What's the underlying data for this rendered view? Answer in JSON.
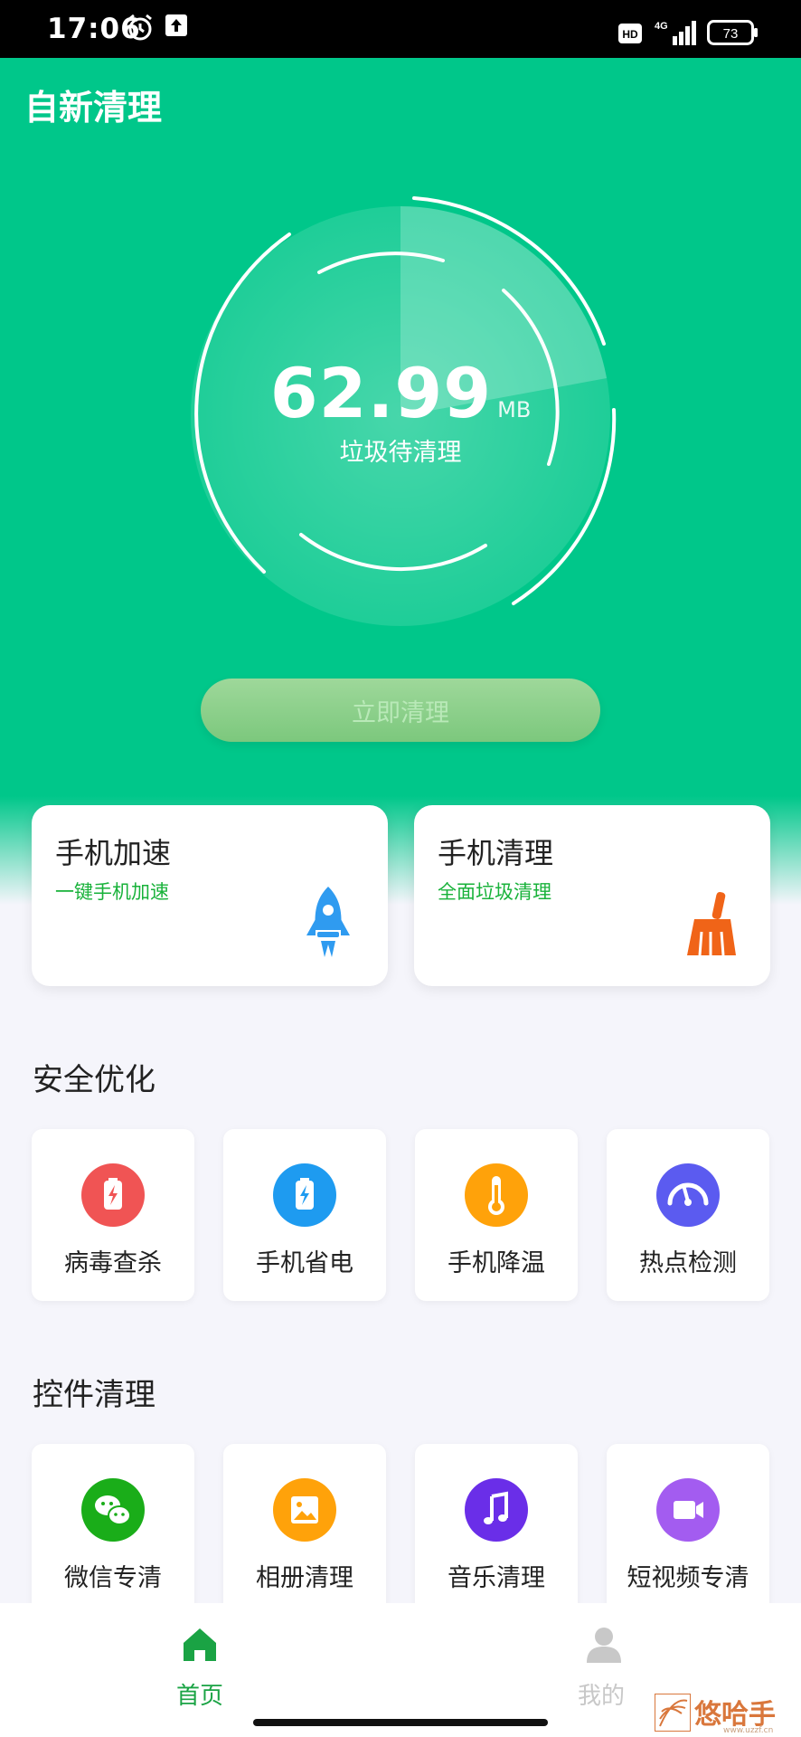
{
  "status_bar": {
    "time": "17:06",
    "hd": "HD",
    "network": "4G",
    "battery": "73"
  },
  "app": {
    "title": "自新清理"
  },
  "junk": {
    "value": "62.99",
    "unit": "MB",
    "caption": "垃圾待清理"
  },
  "clean_button": {
    "label": "立即清理"
  },
  "features": [
    {
      "title": "手机加速",
      "subtitle": "一键手机加速",
      "icon": "rocket-icon"
    },
    {
      "title": "手机清理",
      "subtitle": "全面垃圾清理",
      "icon": "broom-icon"
    }
  ],
  "security": {
    "title": "安全优化",
    "items": [
      {
        "label": "病毒查杀",
        "icon": "virus-scan-icon",
        "color": "#f05454"
      },
      {
        "label": "手机省电",
        "icon": "battery-icon",
        "color": "#1e9bf0"
      },
      {
        "label": "手机降温",
        "icon": "thermometer-icon",
        "color": "#ffa20a"
      },
      {
        "label": "热点检测",
        "icon": "speedometer-icon",
        "color": "#5b5bf0"
      }
    ]
  },
  "widgets": {
    "title": "控件清理",
    "items": [
      {
        "label": "微信专清",
        "icon": "wechat-icon",
        "color": "#1aad19"
      },
      {
        "label": "相册清理",
        "icon": "image-icon",
        "color": "#ffa20a"
      },
      {
        "label": "音乐清理",
        "icon": "music-icon",
        "color": "#6a2ee8"
      },
      {
        "label": "短视频专清",
        "icon": "video-icon",
        "color": "#a35cf0"
      }
    ]
  },
  "nav": {
    "home_label": "首页",
    "mine_label": "我的",
    "active_color": "#1aa344",
    "inactive_color": "#c8c8c8"
  },
  "watermark": {
    "text": "悠哈手游",
    "small": "www.uzzf.cn"
  }
}
